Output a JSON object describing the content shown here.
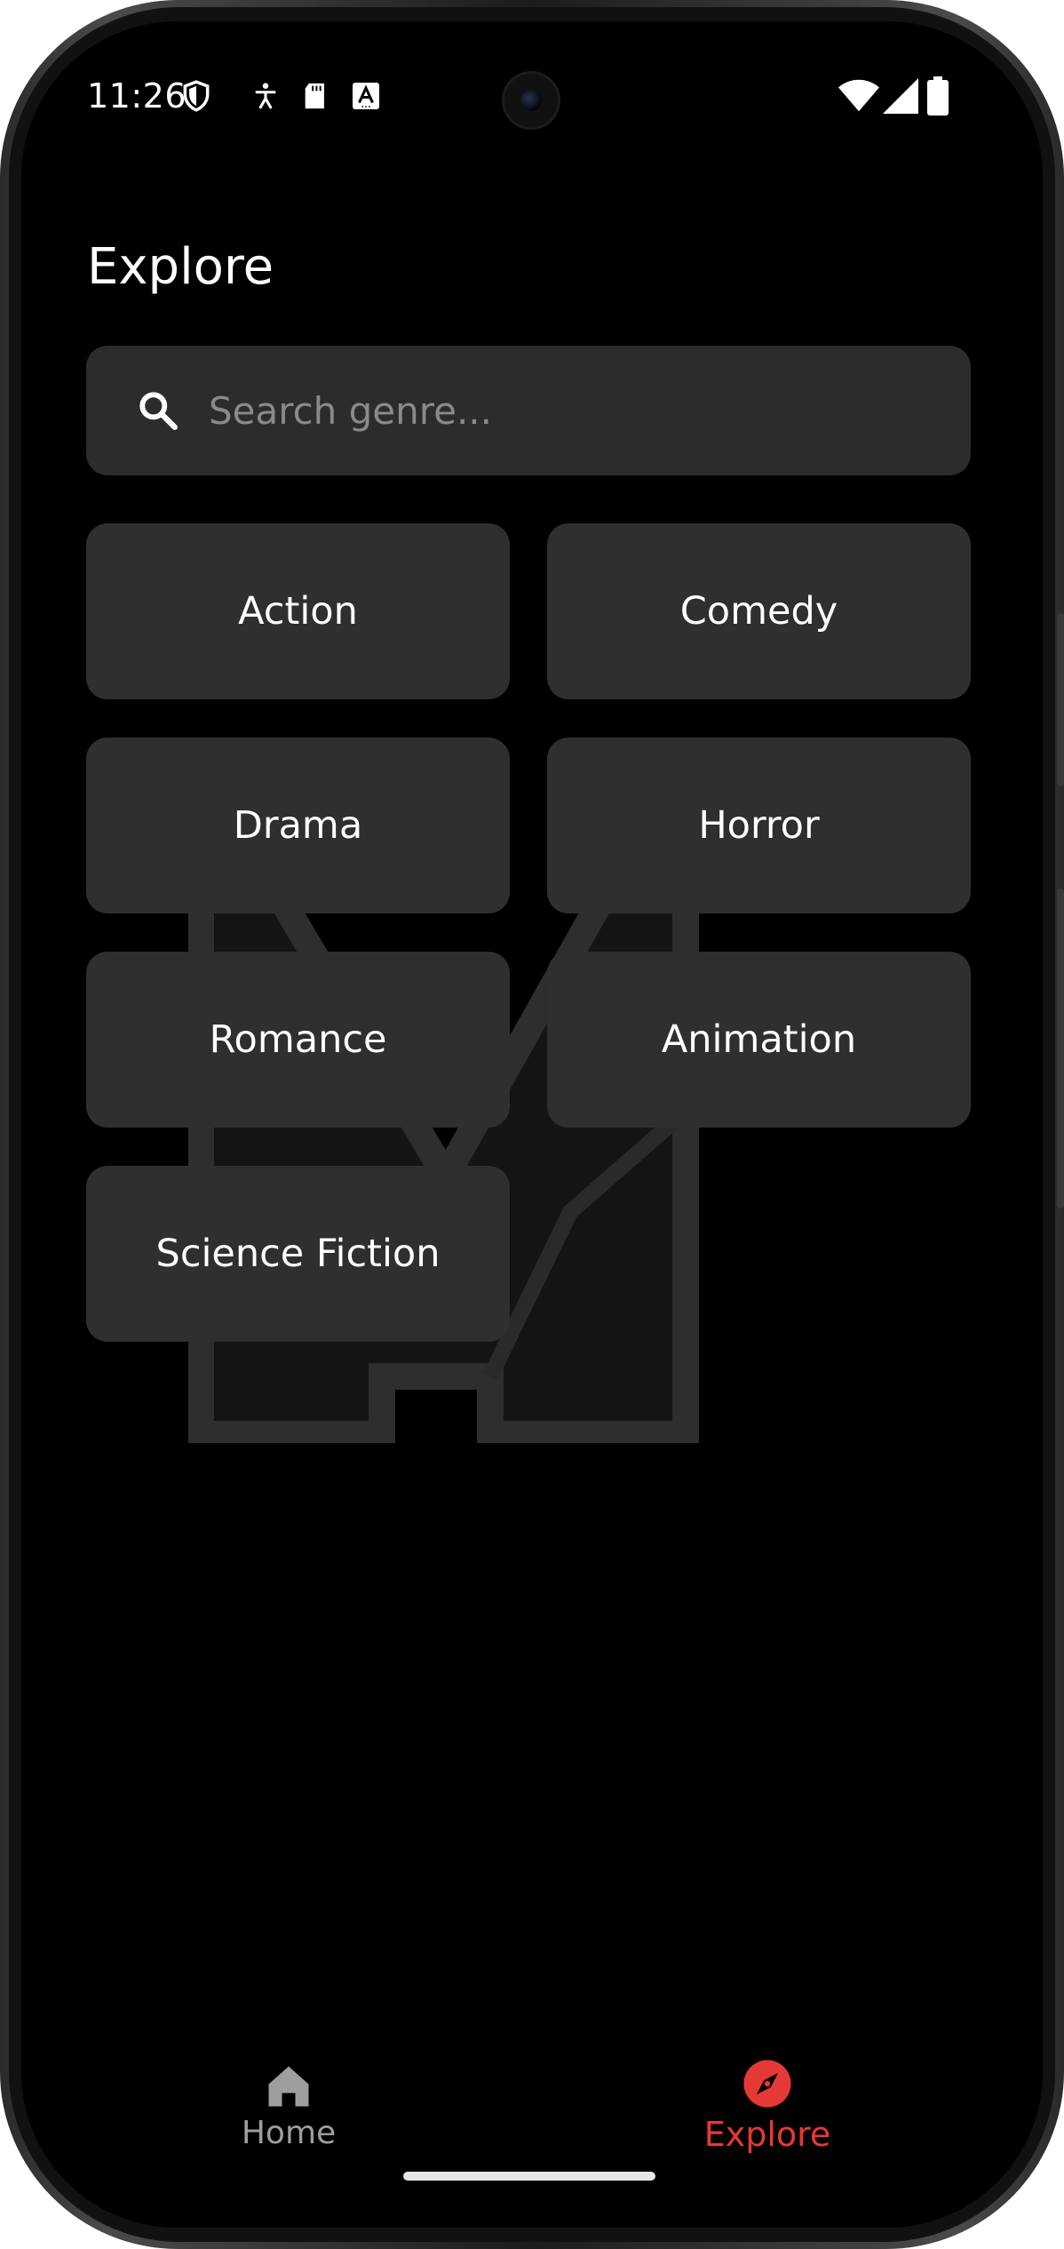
{
  "status_bar": {
    "time": "11:26",
    "left_icons": [
      "shield-icon",
      "accessibility-icon",
      "sd-card-icon",
      "keyboard-a-icon"
    ],
    "right_icons": [
      "wifi-icon",
      "cell-signal-icon",
      "battery-icon"
    ]
  },
  "header": {
    "title": "Explore"
  },
  "search": {
    "placeholder": "Search genre...",
    "value": ""
  },
  "genres": [
    "Action",
    "Comedy",
    "Drama",
    "Horror",
    "Romance",
    "Animation",
    "Science Fiction"
  ],
  "bottom_nav": {
    "items": [
      {
        "label": "Home",
        "icon": "home-icon",
        "active": false
      },
      {
        "label": "Explore",
        "icon": "compass-icon",
        "active": true
      }
    ]
  },
  "colors": {
    "background": "#000000",
    "card": "#2f2f2f",
    "accent": "#e53935",
    "inactive": "#9e9e9e",
    "text": "#ffffff"
  }
}
